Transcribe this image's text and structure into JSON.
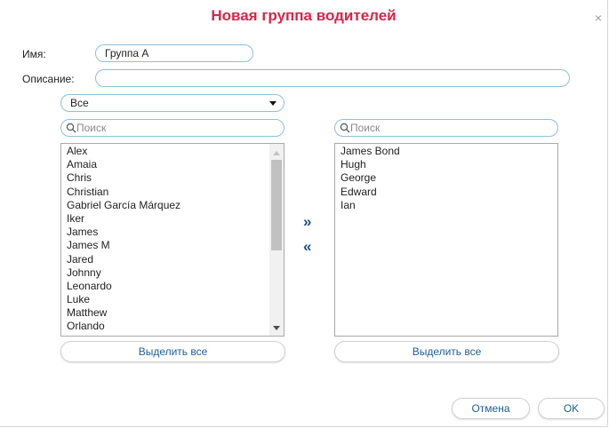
{
  "dialog": {
    "title": "Новая группа водителей",
    "close_glyph": "×"
  },
  "form": {
    "name_label": "Имя:",
    "name_value": "Группа А",
    "description_label": "Описание:",
    "description_value": ""
  },
  "filter": {
    "selected": "Все"
  },
  "left_panel": {
    "search_placeholder": "Поиск",
    "items": [
      "Alex",
      "Amaia",
      "Chris",
      "Christian",
      "Gabriel García Márquez",
      "Iker",
      "James",
      "James M",
      "Jared",
      "Johnny",
      "Leonardo",
      "Luke",
      "Matthew",
      "Orlando"
    ],
    "select_all_label": "Выделить все"
  },
  "right_panel": {
    "search_placeholder": "Поиск",
    "items": [
      "James Bond",
      "Hugh",
      "George",
      "Edward",
      "Ian"
    ],
    "select_all_label": "Выделить все"
  },
  "transfer": {
    "add_glyph": "»",
    "remove_glyph": "«"
  },
  "footer": {
    "cancel_label": "Отмена",
    "ok_label": "OK"
  },
  "colors": {
    "title": "#d6264a",
    "field_border": "#8fc0da",
    "button_text": "#1b5f9a",
    "arrow": "#1e4f86"
  },
  "icons": {
    "search": "search-icon",
    "close": "close-icon",
    "caret": "chevron-down-icon"
  }
}
